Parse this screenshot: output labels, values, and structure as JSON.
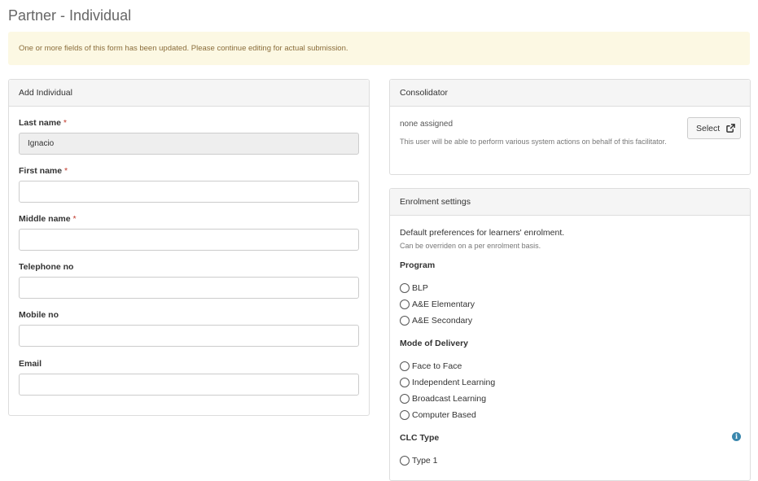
{
  "page": {
    "title": "Partner - Individual"
  },
  "alert": {
    "message": "One or more fields of this form has been updated. Please continue editing for actual submission."
  },
  "add_individual": {
    "heading": "Add Individual",
    "required_mark": "*",
    "fields": [
      {
        "label": "Last name",
        "required": true,
        "value": "Ignacio"
      },
      {
        "label": "First name",
        "required": true,
        "value": ""
      },
      {
        "label": "Middle name",
        "required": true,
        "value": ""
      },
      {
        "label": "Telephone no",
        "required": false,
        "value": ""
      },
      {
        "label": "Mobile no",
        "required": false,
        "value": ""
      },
      {
        "label": "Email",
        "required": false,
        "value": ""
      }
    ]
  },
  "consolidator": {
    "heading": "Consolidator",
    "none_text": "none assigned",
    "help_text": "This user will be able to perform various system actions on behalf of this facilitator.",
    "select_label": "Select"
  },
  "enrolment": {
    "heading": "Enrolment settings",
    "description": "Default preferences for learners' enrolment.",
    "sub_description": "Can be overriden on a per enrolment basis.",
    "program": {
      "label": "Program",
      "options": [
        "BLP",
        "A&E Elementary",
        "A&E Secondary"
      ]
    },
    "mode": {
      "label": "Mode of Delivery",
      "options": [
        "Face to Face",
        "Independent Learning",
        "Broadcast Learning",
        "Computer Based"
      ]
    },
    "clc_type": {
      "label": "CLC Type",
      "options": [
        "Type 1"
      ]
    }
  },
  "colors": {
    "alert_bg": "#fcf8e3",
    "alert_text": "#8a6d3b",
    "required": "#c0392b",
    "info": "#3a87ad"
  },
  "icons": {
    "select_button": "external-link-icon",
    "clc_info": "info-icon"
  }
}
